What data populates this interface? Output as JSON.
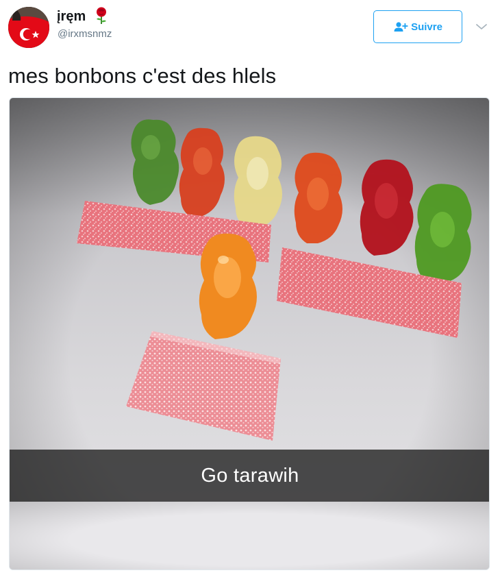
{
  "tweet": {
    "author": {
      "display_name": "įręm",
      "handle": "@irxmsnmz",
      "name_emoji": "rose-icon",
      "avatar": "avatar-turkish-flag"
    },
    "follow_button": {
      "label": "Suivre",
      "icon": "follow-user-icon"
    },
    "menu_icon": "chevron-down-icon",
    "text": "mes bonbons c'est des hlels",
    "media": {
      "caption": "Go tarawih"
    },
    "colors": {
      "accent": "#1da1f2",
      "text": "#14171a",
      "secondary_text": "#657786",
      "rose": "#d0021b"
    }
  }
}
